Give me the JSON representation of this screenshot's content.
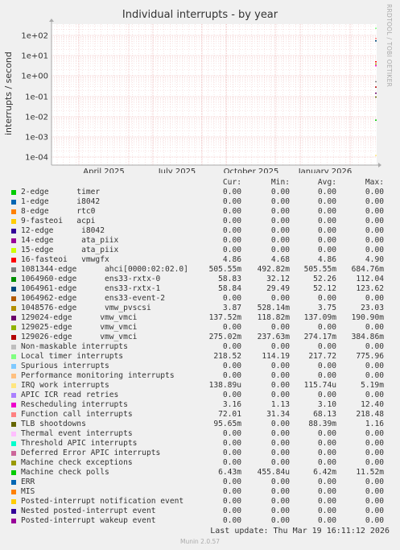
{
  "chart_data": {
    "type": "line",
    "title": "Individual interrupts - by year",
    "ylabel": "interrupts / second",
    "yscale": "log",
    "ylim": [
      5e-05,
      200
    ],
    "y_ticks": [
      "1e+02",
      "1e+01",
      "1e+00",
      "1e-01",
      "1e-02",
      "1e-03",
      "1e-04"
    ],
    "x_ticks": [
      "April 2025",
      "July 2025",
      "October 2025",
      "January 2026"
    ],
    "grid": true,
    "side_label": "RRDTOOL / TOBI OETIKER",
    "columns": [
      "Cur:",
      "Min:",
      "Avg:",
      "Max:"
    ],
    "series": [
      {
        "name": "2-edge      timer",
        "color": "#00cc00",
        "cur": "0.00",
        "min": "0.00",
        "avg": "0.00",
        "max": "0.00"
      },
      {
        "name": "1-edge      i8042",
        "color": "#0066b3",
        "cur": "0.00",
        "min": "0.00",
        "avg": "0.00",
        "max": "0.00"
      },
      {
        "name": "8-edge      rtc0",
        "color": "#ff8000",
        "cur": "0.00",
        "min": "0.00",
        "avg": "0.00",
        "max": "0.00"
      },
      {
        "name": "9-fasteoi   acpi",
        "color": "#ffcc00",
        "cur": "0.00",
        "min": "0.00",
        "avg": "0.00",
        "max": "0.00"
      },
      {
        "name": "12-edge      i8042",
        "color": "#330099",
        "cur": "0.00",
        "min": "0.00",
        "avg": "0.00",
        "max": "0.00"
      },
      {
        "name": "14-edge      ata_piix",
        "color": "#990099",
        "cur": "0.00",
        "min": "0.00",
        "avg": "0.00",
        "max": "0.00"
      },
      {
        "name": "15-edge      ata_piix",
        "color": "#ccff00",
        "cur": "0.00",
        "min": "0.00",
        "avg": "0.00",
        "max": "0.00"
      },
      {
        "name": "16-fasteoi   vmwgfx",
        "color": "#ff0000",
        "cur": "4.86",
        "min": "4.68",
        "avg": "4.86",
        "max": "4.90"
      },
      {
        "name": "1081344-edge      ahci[0000:02:02.0]",
        "color": "#808080",
        "cur": "505.55m",
        "min": "492.82m",
        "avg": "505.55m",
        "max": "684.76m"
      },
      {
        "name": "1064960-edge      ens33-rxtx-0",
        "color": "#008f00",
        "cur": "58.83",
        "min": "32.12",
        "avg": "52.26",
        "max": "112.04"
      },
      {
        "name": "1064961-edge      ens33-rxtx-1",
        "color": "#00487d",
        "cur": "58.84",
        "min": "29.49",
        "avg": "52.12",
        "max": "123.62"
      },
      {
        "name": "1064962-edge      ens33-event-2",
        "color": "#b35a00",
        "cur": "0.00",
        "min": "0.00",
        "avg": "0.00",
        "max": "0.00"
      },
      {
        "name": "1048576-edge      vmw_pvscsi",
        "color": "#b38f00",
        "cur": "3.87",
        "min": "528.14m",
        "avg": "3.75",
        "max": "23.03"
      },
      {
        "name": "129024-edge      vmw_vmci",
        "color": "#6b006b",
        "cur": "137.52m",
        "min": "118.82m",
        "avg": "137.09m",
        "max": "190.90m"
      },
      {
        "name": "129025-edge      vmw_vmci",
        "color": "#8fb300",
        "cur": "0.00",
        "min": "0.00",
        "avg": "0.00",
        "max": "0.00"
      },
      {
        "name": "129026-edge      vmw_vmci",
        "color": "#b30000",
        "cur": "275.02m",
        "min": "237.63m",
        "avg": "274.17m",
        "max": "384.86m"
      },
      {
        "name": "Non-maskable interrupts",
        "color": "#bebebe",
        "cur": "0.00",
        "min": "0.00",
        "avg": "0.00",
        "max": "0.00"
      },
      {
        "name": "Local timer interrupts",
        "color": "#80ff80",
        "cur": "218.52",
        "min": "114.19",
        "avg": "217.72",
        "max": "775.96"
      },
      {
        "name": "Spurious interrupts",
        "color": "#80c9ff",
        "cur": "0.00",
        "min": "0.00",
        "avg": "0.00",
        "max": "0.00"
      },
      {
        "name": "Performance monitoring interrupts",
        "color": "#ffc080",
        "cur": "0.00",
        "min": "0.00",
        "avg": "0.00",
        "max": "0.00"
      },
      {
        "name": "IRQ work interrupts",
        "color": "#ffe680",
        "cur": "138.89u",
        "min": "0.00",
        "avg": "115.74u",
        "max": "5.19m"
      },
      {
        "name": "APIC ICR read retries",
        "color": "#aa80ff",
        "cur": "0.00",
        "min": "0.00",
        "avg": "0.00",
        "max": "0.00"
      },
      {
        "name": "Rescheduling interrupts",
        "color": "#ee00cc",
        "cur": "3.16",
        "min": "1.13",
        "avg": "3.10",
        "max": "12.40"
      },
      {
        "name": "Function call interrupts",
        "color": "#ff8080",
        "cur": "72.01",
        "min": "31.34",
        "avg": "68.13",
        "max": "218.48"
      },
      {
        "name": "TLB shootdowns",
        "color": "#666600",
        "cur": "95.65m",
        "min": "0.00",
        "avg": "88.39m",
        "max": "1.16"
      },
      {
        "name": "Thermal event interrupts",
        "color": "#ffbfff",
        "cur": "0.00",
        "min": "0.00",
        "avg": "0.00",
        "max": "0.00"
      },
      {
        "name": "Threshold APIC interrupts",
        "color": "#00ffcc",
        "cur": "0.00",
        "min": "0.00",
        "avg": "0.00",
        "max": "0.00"
      },
      {
        "name": "Deferred Error APIC interrupts",
        "color": "#cc6699",
        "cur": "0.00",
        "min": "0.00",
        "avg": "0.00",
        "max": "0.00"
      },
      {
        "name": "Machine check exceptions",
        "color": "#999900",
        "cur": "0.00",
        "min": "0.00",
        "avg": "0.00",
        "max": "0.00"
      },
      {
        "name": "Machine check polls",
        "color": "#00cc00",
        "cur": "6.43m",
        "min": "455.84u",
        "avg": "6.42m",
        "max": "11.52m"
      },
      {
        "name": "ERR",
        "color": "#0066b3",
        "cur": "0.00",
        "min": "0.00",
        "avg": "0.00",
        "max": "0.00"
      },
      {
        "name": "MIS",
        "color": "#ff8000",
        "cur": "0.00",
        "min": "0.00",
        "avg": "0.00",
        "max": "0.00"
      },
      {
        "name": "Posted-interrupt notification event",
        "color": "#ffcc00",
        "cur": "0.00",
        "min": "0.00",
        "avg": "0.00",
        "max": "0.00"
      },
      {
        "name": "Nested posted-interrupt event",
        "color": "#330099",
        "cur": "0.00",
        "min": "0.00",
        "avg": "0.00",
        "max": "0.00"
      },
      {
        "name": "Posted-interrupt wakeup event",
        "color": "#990099",
        "cur": "0.00",
        "min": "0.00",
        "avg": "0.00",
        "max": "0.00"
      }
    ]
  },
  "last_update": "Last update: Thu Mar 19 16:11:12 2026",
  "footer": "Munin 2.0.57"
}
